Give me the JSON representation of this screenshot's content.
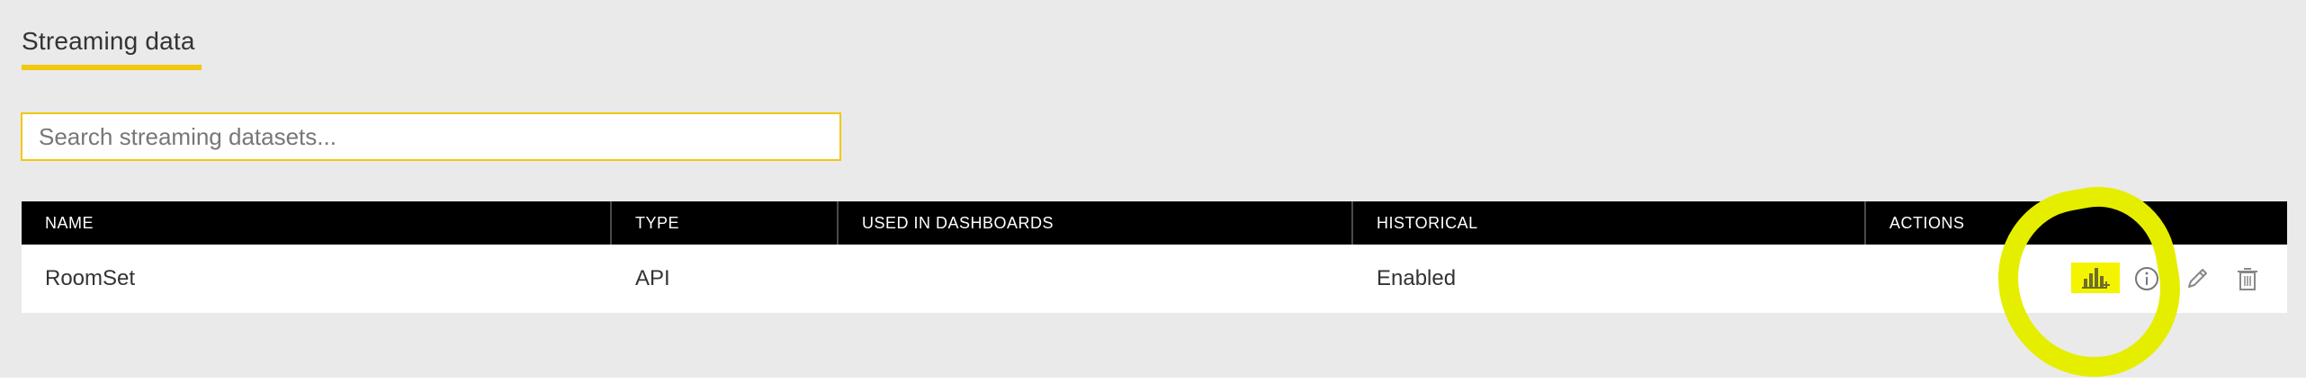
{
  "page": {
    "title": "Streaming data"
  },
  "search": {
    "placeholder": "Search streaming datasets..."
  },
  "table": {
    "columns": [
      "NAME",
      "TYPE",
      "USED IN DASHBOARDS",
      "HISTORICAL",
      "ACTIONS"
    ],
    "rows": [
      {
        "name": "RoomSet",
        "type": "API",
        "used_in_dashboards": "",
        "historical": "Enabled",
        "actions": [
          "create-report-icon",
          "info-icon",
          "edit-icon",
          "delete-icon"
        ]
      }
    ]
  },
  "colors": {
    "accent": "#f2c811",
    "header_bg": "#000000",
    "panel_bg": "#eaeaea",
    "annotation": "#e6ee00"
  }
}
